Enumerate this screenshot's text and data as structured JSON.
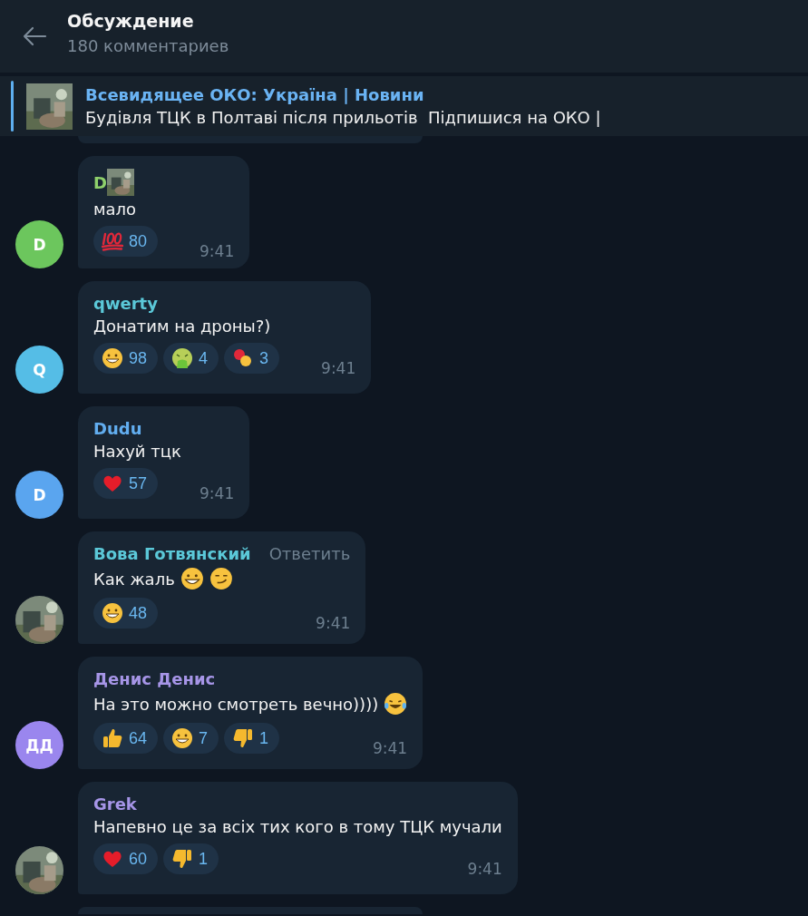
{
  "header": {
    "title": "Обсуждение",
    "subtitle": "180 комментариев"
  },
  "pinned": {
    "thumbnail": {
      "kind": "picture"
    },
    "title": "Всевидящее ОКО: Україна | Новини",
    "text": "Будівля ТЦК в Полтаві після прильотів  Підпишися на ОКО |"
  },
  "messages": [
    {
      "author": "D",
      "color": "#8fd16b",
      "author_picture": {
        "kind": "picture"
      },
      "avatar": {
        "kind": "letter",
        "text": "D",
        "color": "#6cc65d"
      },
      "text": "мало",
      "reactions": [
        {
          "kind": "hundred",
          "count": "80"
        }
      ],
      "time": "9:41"
    },
    {
      "author": "qwerty",
      "color": "#5bc8d8",
      "avatar": {
        "kind": "letter",
        "text": "Q",
        "color": "#55bde6"
      },
      "text": "Донатим на дроны?)",
      "reactions": [
        {
          "kind": "grin",
          "count": "98"
        },
        {
          "kind": "nauseated",
          "count": "4"
        },
        {
          "kind": "pill",
          "count": "3"
        }
      ],
      "time": "9:41"
    },
    {
      "author": "Dudu",
      "color": "#62aef0",
      "avatar": {
        "kind": "letter",
        "text": "D",
        "color": "#5aa5ef"
      },
      "text": "Нахуй тцк",
      "reactions": [
        {
          "kind": "heart",
          "count": "57"
        }
      ],
      "time": "9:41"
    },
    {
      "author": "Вова Готвянский",
      "color": "#5bc8d8",
      "reply": "Ответить",
      "avatar": {
        "kind": "picture"
      },
      "text": "Как жаль",
      "inline_emoji": [
        {
          "kind": "grin"
        },
        {
          "kind": "smirk"
        }
      ],
      "reactions": [
        {
          "kind": "grin",
          "count": "48"
        }
      ],
      "time": "9:41"
    },
    {
      "author": "Денис Денис",
      "color": "#a695e7",
      "avatar": {
        "kind": "letter",
        "text": "ДД",
        "color": "#9a86ee"
      },
      "text": "На это можно смотреть вечно))))",
      "inline_emoji": [
        {
          "kind": "joy"
        }
      ],
      "reactions": [
        {
          "kind": "thumbs_up",
          "count": "64"
        },
        {
          "kind": "grin",
          "count": "7"
        },
        {
          "kind": "thumbs_down",
          "count": "1"
        }
      ],
      "time": "9:41"
    },
    {
      "author": "Grek",
      "color": "#a695e7",
      "avatar": {
        "kind": "picture"
      },
      "text": "Напевно це за всіх тих кого в тому ТЦК мучали",
      "reactions": [
        {
          "kind": "heart",
          "count": "60"
        },
        {
          "kind": "thumbs_down",
          "count": "1"
        }
      ],
      "time": "9:41"
    }
  ]
}
